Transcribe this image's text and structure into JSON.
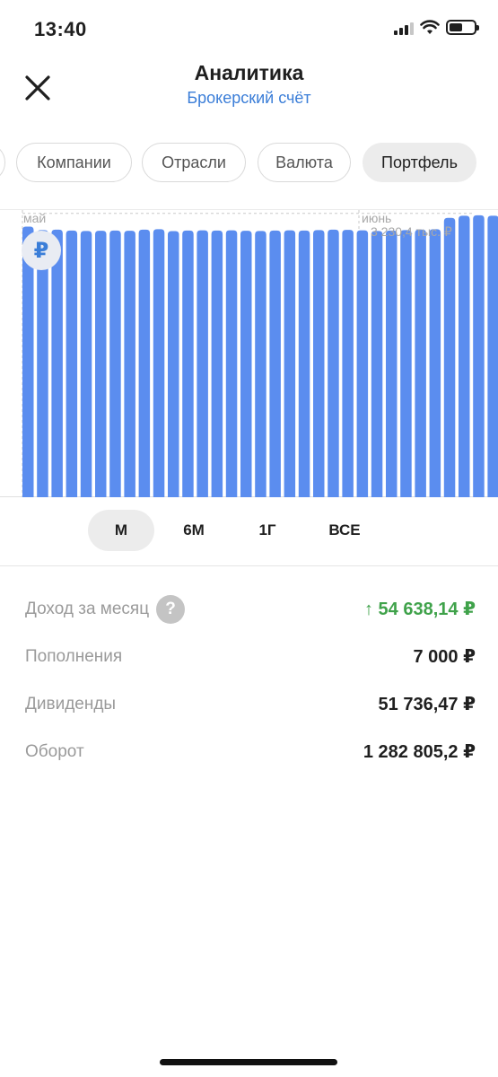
{
  "status_bar": {
    "time": "13:40",
    "icons": [
      "signal-icon",
      "wifi-icon",
      "battery-icon"
    ]
  },
  "header": {
    "close_icon": "close-icon",
    "title": "Аналитика",
    "subtitle": "Брокерский счёт"
  },
  "tabs": [
    {
      "label": "Компании",
      "active": false
    },
    {
      "label": "Отрасли",
      "active": false
    },
    {
      "label": "Валюта",
      "active": false
    },
    {
      "label": "Портфель",
      "active": true
    }
  ],
  "chart": {
    "month_labels": [
      "май",
      "июнь"
    ],
    "max_label": "3 230,4 тыс. ₽",
    "badge_symbol": "₽",
    "bar_color": "#5b8def"
  },
  "chart_data": {
    "type": "bar",
    "series": [
      {
        "values": [
          3100,
          3060,
          3065,
          3055,
          3050,
          3052,
          3055,
          3052,
          3065,
          3070,
          3048,
          3055,
          3058,
          3055,
          3058,
          3052,
          3050,
          3055,
          3058,
          3055,
          3060,
          3065,
          3062,
          3058,
          3050,
          3055,
          3060,
          3065,
          3070,
          3200,
          3225,
          3230,
          3224,
          3222,
          3226,
          3228,
          3218,
          3215
        ]
      }
    ],
    "max_value": 3230.4,
    "max_value_label": "3 230,4 тыс. ₽",
    "ylim": [
      0,
      3290
    ],
    "xlabel": "",
    "ylabel": "",
    "grid": false
  },
  "periods": [
    {
      "label": "М",
      "active": true
    },
    {
      "label": "6М",
      "active": false
    },
    {
      "label": "1Г",
      "active": false
    },
    {
      "label": "ВСЕ",
      "active": false
    }
  ],
  "stats": {
    "income": {
      "label": "Доход за месяц",
      "help": "?",
      "arrow": "↑",
      "value": "54 638,14 ₽",
      "color": "#3fa24a"
    },
    "deposits": {
      "label": "Пополнения",
      "value": "7 000 ₽"
    },
    "dividends": {
      "label": "Дивиденды",
      "value": "51 736,47 ₽"
    },
    "turnover": {
      "label": "Оборот",
      "value": "1 282 805,2 ₽"
    }
  }
}
